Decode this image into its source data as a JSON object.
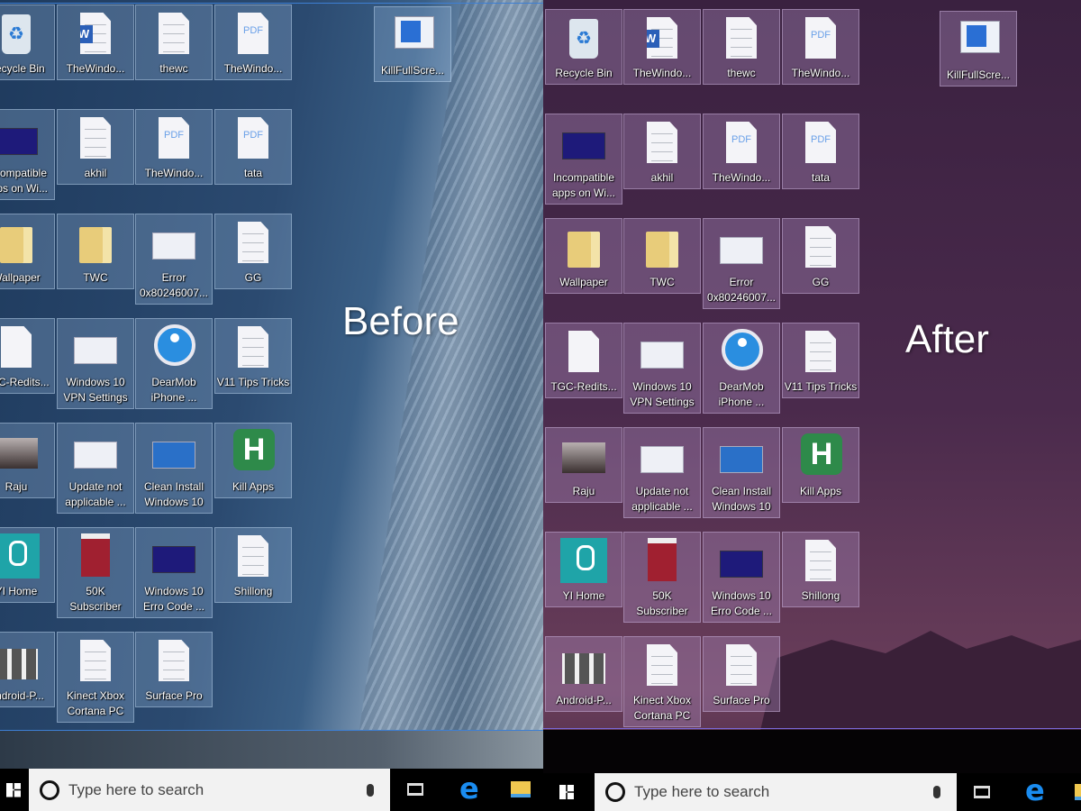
{
  "captions": {
    "before": "Before",
    "after": "After"
  },
  "desktop": {
    "items": [
      {
        "label": "Recycle Bin",
        "icon": "recycle"
      },
      {
        "label": "TheWindo...",
        "icon": "word"
      },
      {
        "label": "thewc",
        "icon": "doc"
      },
      {
        "label": "TheWindo...",
        "icon": "pdf"
      },
      {
        "label": "Incompatible apps on Wi...",
        "icon": "dark-screen"
      },
      {
        "label": "akhil",
        "icon": "doc"
      },
      {
        "label": "TheWindo...",
        "icon": "pdf"
      },
      {
        "label": "tata",
        "icon": "pdf"
      },
      {
        "label": "Wallpaper",
        "icon": "folder"
      },
      {
        "label": "TWC",
        "icon": "folder"
      },
      {
        "label": "Error 0x80246007...",
        "icon": "screenshot"
      },
      {
        "label": "GG",
        "icon": "doc"
      },
      {
        "label": "TGC-Redits...",
        "icon": "blank"
      },
      {
        "label": "Windows 10 VPN Settings",
        "icon": "screenshot"
      },
      {
        "label": "DearMob iPhone ...",
        "icon": "dearmob"
      },
      {
        "label": "V11 Tips Tricks",
        "icon": "doc"
      },
      {
        "label": "Raju",
        "icon": "photo"
      },
      {
        "label": "Update not applicable ...",
        "icon": "screenshot"
      },
      {
        "label": "Clean Install Windows 10",
        "icon": "blue-screen"
      },
      {
        "label": "Kill Apps",
        "icon": "killapps"
      },
      {
        "label": "YI Home",
        "icon": "yi"
      },
      {
        "label": "50K Subscriber",
        "icon": "book"
      },
      {
        "label": "Windows 10 Erro Code ...",
        "icon": "dark-screen"
      },
      {
        "label": "Shillong",
        "icon": "doc"
      },
      {
        "label": "Android-P...",
        "icon": "phones"
      },
      {
        "label": "Kinect Xbox Cortana PC",
        "icon": "doc"
      },
      {
        "label": "Surface Pro",
        "icon": "doc"
      }
    ],
    "shortcut": {
      "label": "KillFullScre...",
      "icon": "shortcut"
    }
  },
  "taskbar": {
    "search_placeholder": "Type here to search",
    "pdf_text": "PDF",
    "kill_letter": "H"
  }
}
